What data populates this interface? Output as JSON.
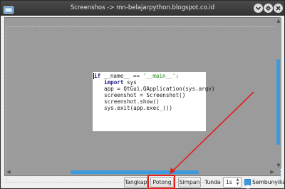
{
  "window": {
    "title": "Screenshos -> mn-belajarpython.blogspot.co.id"
  },
  "icons": {
    "app": "screenshot-app-icon",
    "minimize": "minimize-icon",
    "maximize": "maximize-icon",
    "close": "close-icon"
  },
  "code": {
    "lines": [
      [
        "if ",
        "__name__",
        " == ",
        "'__main__'",
        ":"
      ],
      [
        "import",
        " sys"
      ],
      [
        "app = QtGui.QApplication(sys.argv)"
      ],
      [
        "screenshot = Screenshot()"
      ],
      [
        "screenshot.show()"
      ],
      [
        "sys.exit(app.exec_())"
      ]
    ]
  },
  "toolbar": {
    "take_label": "Tangkap",
    "cut_label": "Potong",
    "save_label": "Simpan",
    "delay_label": "Tunda",
    "delay_value": "1s",
    "hide_label": "Sembunyikan",
    "hide_checked": true
  },
  "colors": {
    "accent": "#3a9be0",
    "highlight": "#e0201c"
  }
}
